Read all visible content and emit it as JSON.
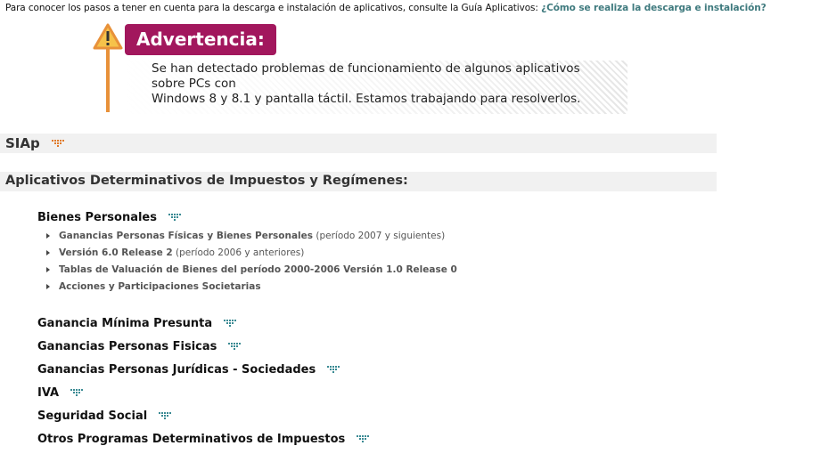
{
  "intro": {
    "text": "Para conocer los pasos a tener en cuenta para la descarga e instalación de aplicativos, consulte la Guía Aplicativos: ",
    "link": "¿Cómo se realiza la descarga e instalación?"
  },
  "warning": {
    "title": "Advertencia:",
    "line1": "Se han detectado problemas de funcionamiento de algunos aplicativos sobre PCs con",
    "line2": "Windows 8 y 8.1 y pantalla táctil. Estamos trabajando para resolverlos.",
    "icon": "warning-triangle-icon"
  },
  "sections": {
    "siap": "SIAp",
    "aplicativos": "Aplicativos Determinativos de Impuestos y Regímenes:"
  },
  "categories": {
    "bienes": "Bienes Personales",
    "gmp": "Ganancia Mínima Presunta",
    "gpf": "Ganancias Personas Fisicas",
    "gpj": "Ganancias Personas Jurídicas - Sociedades",
    "iva": "IVA",
    "seguridad": "Seguridad Social",
    "otros": "Otros Programas Determinativos de Impuestos"
  },
  "bienes_items": [
    {
      "link": "Ganancias Personas Físicas y Bienes Personales",
      "suffix": " (período 2007 y siguientes)"
    },
    {
      "link": "Versión 6.0 Release 2",
      "suffix": " (período 2006 y anteriores)"
    },
    {
      "link": "Tablas de Valuación de Bienes del período 2000-2006 Versión 1.0 Release 0",
      "suffix": ""
    },
    {
      "link": "Acciones y Participaciones Societarias",
      "suffix": ""
    }
  ],
  "colors": {
    "accent_magenta": "#a2175d",
    "accent_orange": "#e8913a",
    "dots_teal": "#3a8a93",
    "dots_orange": "#e07a2a",
    "link": "#3f7a7e"
  }
}
